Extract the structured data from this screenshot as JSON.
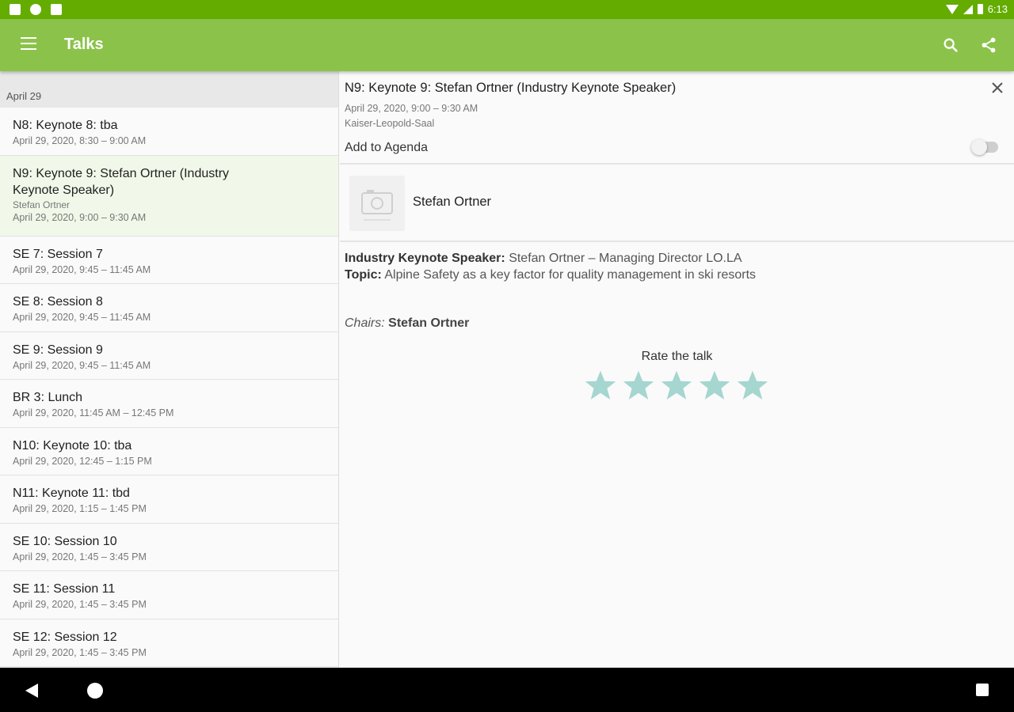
{
  "status_bar": {
    "time": "6:13"
  },
  "app_bar": {
    "title": "Talks"
  },
  "list": {
    "day_header": "April 29",
    "talks": [
      {
        "title": "N8: Keynote 8: tba",
        "time": "April 29, 2020, 8:30 – 9:00 AM"
      },
      {
        "title": "N9: Keynote 9: Stefan Ortner (Industry Keynote Speaker)",
        "speaker": "Stefan Ortner",
        "time": "April 29, 2020, 9:00 – 9:30 AM"
      },
      {
        "title": "SE 7: Session 7",
        "time": "April 29, 2020, 9:45 – 11:45 AM"
      },
      {
        "title": "SE 8: Session 8",
        "time": "April 29, 2020, 9:45 – 11:45 AM"
      },
      {
        "title": "SE 9: Session 9",
        "time": "April 29, 2020, 9:45 – 11:45 AM"
      },
      {
        "title": "BR 3: Lunch",
        "time": "April 29, 2020, 11:45 AM – 12:45 PM"
      },
      {
        "title": "N10: Keynote 10: tba",
        "time": "April 29, 2020, 12:45 – 1:15 PM"
      },
      {
        "title": "N11: Keynote 11: tbd",
        "time": "April 29, 2020, 1:15 – 1:45 PM"
      },
      {
        "title": "SE 10: Session 10",
        "time": "April 29, 2020, 1:45 – 3:45 PM"
      },
      {
        "title": "SE 11: Session 11",
        "time": "April 29, 2020, 1:45 – 3:45 PM"
      },
      {
        "title": "SE 12: Session 12",
        "time": "April 29, 2020, 1:45 – 3:45 PM"
      }
    ]
  },
  "detail": {
    "title": "N9: Keynote 9: Stefan Ortner (Industry Keynote Speaker)",
    "time": "April 29, 2020, 9:00 – 9:30 AM",
    "room": "Kaiser-Leopold-Saal",
    "agenda_label": "Add to Agenda",
    "agenda_enabled": false,
    "speaker_name": "Stefan Ortner",
    "description": {
      "speaker_label": "Industry Keynote Speaker:",
      "speaker_text": "Stefan Ortner – Managing Director LO.LA",
      "topic_label": "Topic:",
      "topic_text": "Alpine Safety as a key factor for quality management in ski resorts"
    },
    "chairs_label": "Chairs:",
    "chairs_name": "Stefan Ortner",
    "rate_label": "Rate the talk",
    "rating_stars": 5
  },
  "colors": {
    "status_bar": "#64ad00",
    "app_bar": "#8bc34a",
    "selected_row": "#f1f8e9",
    "star": "#a5d6d0"
  }
}
